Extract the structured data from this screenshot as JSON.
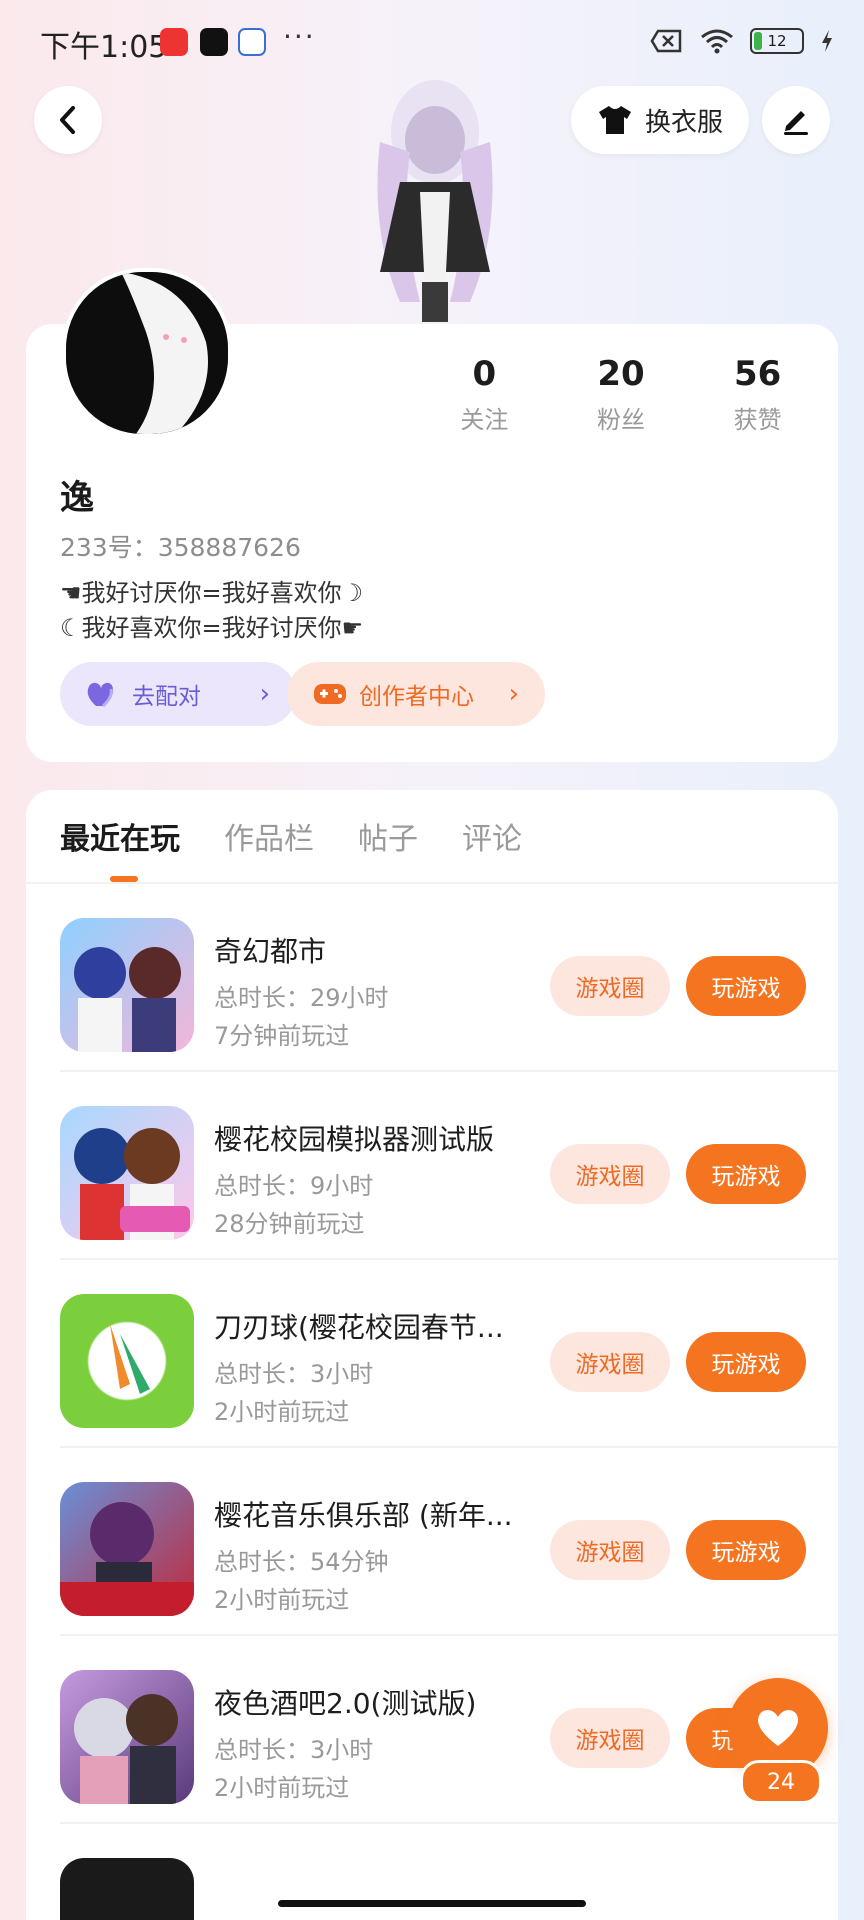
{
  "status_bar": {
    "time": "下午1:05",
    "battery": "12"
  },
  "header": {
    "outfit_label": "换衣服"
  },
  "profile": {
    "stats": [
      {
        "value": "0",
        "label": "关注"
      },
      {
        "value": "20",
        "label": "粉丝"
      },
      {
        "value": "56",
        "label": "获赞"
      }
    ],
    "nickname": "逸",
    "uid": "233号：358887626",
    "bio_line1": "☚我好讨厌你=我好喜欢你☽",
    "bio_line2": "☾我好喜欢你=我好讨厌你☛",
    "match_label": "去配对",
    "creator_label": "创作者中心"
  },
  "tabs": [
    "最近在玩",
    "作品栏",
    "帖子",
    "评论"
  ],
  "games": [
    {
      "title": "奇幻都市",
      "duration": "总时长：29小时",
      "last_played": "7分钟前玩过",
      "circle": "游戏圈",
      "play": "玩游戏",
      "icon_color": "#5aa0e8"
    },
    {
      "title": "樱花校园模拟器测试版",
      "duration": "总时长：9小时",
      "last_played": "28分钟前玩过",
      "circle": "游戏圈",
      "play": "玩游戏",
      "icon_color": "#e9a2d9"
    },
    {
      "title": "刀刃球(樱花校园春节...",
      "duration": "总时长：3小时",
      "last_played": "2小时前玩过",
      "circle": "游戏圈",
      "play": "玩游戏",
      "icon_color": "#7ccf3c"
    },
    {
      "title": "樱花音乐俱乐部 (新年...",
      "duration": "总时长：54分钟",
      "last_played": "2小时前玩过",
      "circle": "游戏圈",
      "play": "玩游戏",
      "icon_color": "#c02a3c"
    },
    {
      "title": "夜色酒吧2.0(测试版)",
      "duration": "总时长：3小时",
      "last_played": "2小时前玩过",
      "circle": "游戏圈",
      "play": "玩游戏",
      "icon_color": "#7d4a9c"
    }
  ],
  "fab": {
    "count": "24"
  },
  "accent_color": "#f4741f"
}
